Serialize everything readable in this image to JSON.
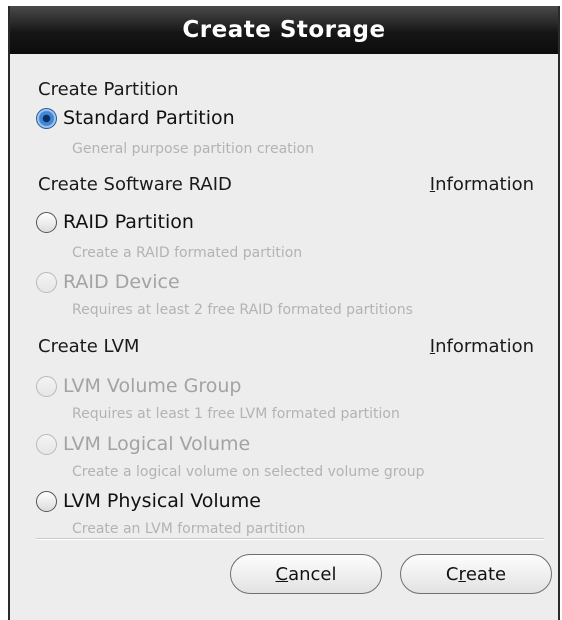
{
  "dialog": {
    "title": "Create Storage"
  },
  "sections": {
    "partition": {
      "header": "Create Partition",
      "options": [
        {
          "label": "Standard Partition",
          "description": "General purpose partition creation",
          "selected": true,
          "enabled": true
        }
      ]
    },
    "raid": {
      "header": "Create Software RAID",
      "info_mnemonic": "I",
      "info_rest": "nformation",
      "options": [
        {
          "label": "RAID Partition",
          "description": "Create a RAID formated partition",
          "selected": false,
          "enabled": true
        },
        {
          "label": "RAID Device",
          "description": "Requires at least 2 free RAID formated partitions",
          "selected": false,
          "enabled": false
        }
      ]
    },
    "lvm": {
      "header": "Create LVM",
      "info_mnemonic": "I",
      "info_rest": "nformation",
      "options": [
        {
          "label": "LVM Volume Group",
          "description": "Requires at least 1 free LVM formated partition",
          "selected": false,
          "enabled": false
        },
        {
          "label": "LVM Logical Volume",
          "description": "Create a logical volume on selected volume group",
          "selected": false,
          "enabled": false
        },
        {
          "label": "LVM Physical Volume",
          "description": "Create an LVM formated partition",
          "selected": false,
          "enabled": true
        }
      ]
    }
  },
  "buttons": {
    "cancel_mnemonic": "C",
    "cancel_rest": "ancel",
    "create_pre": "C",
    "create_mnemonic": "r",
    "create_rest": "eate"
  },
  "colors": {
    "title_bar": "#111111",
    "dialog_bg": "#ededed",
    "selected_radio": "#3f86d6",
    "disabled_text": "#a3a3a3"
  }
}
